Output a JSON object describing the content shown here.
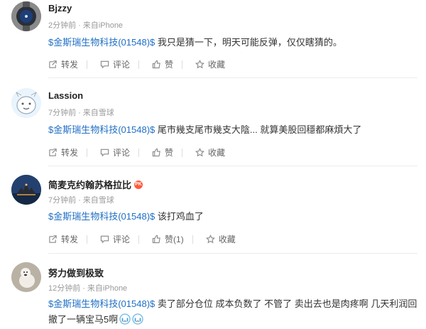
{
  "posts": [
    {
      "name": "Bjzzy",
      "time": "2分钟前",
      "source": "来自iPhone",
      "stock": "$金斯瑞生物科技(01548)$",
      "text": "我只是猜一下，明天可能反弹，仅仅瞎猜的。",
      "repost": "转发",
      "comment": "评论",
      "like": "赞",
      "fav": "收藏"
    },
    {
      "name": "Lassion",
      "time": "7分钟前",
      "source": "来自雪球",
      "stock": "$金斯瑞生物科技(01548)$",
      "text": "尾市幾支尾市幾支大陰... 就算美股回穩都麻煩大了",
      "repost": "转发",
      "comment": "评论",
      "like": "赞",
      "fav": "收藏"
    },
    {
      "name": "简麦克约翰苏格拉比",
      "badge": "PK",
      "time": "7分钟前",
      "source": "来自雪球",
      "stock": "$金斯瑞生物科技(01548)$",
      "text": "该打鸡血了",
      "repost": "转发",
      "comment": "评论",
      "like": "赞(1)",
      "fav": "收藏"
    },
    {
      "name": "努力做到极致",
      "time": "12分钟前",
      "source": "来自iPhone",
      "stock": "$金斯瑞生物科技(01548)$",
      "text": "卖了部分仓位 成本负数了 不管了 卖出去也是肉疼啊 几天利润回撤了一辆宝马5啊"
    }
  ],
  "separator": "·",
  "icons": [
    "share-icon",
    "comment-icon",
    "thumb-up-icon",
    "star-icon",
    "crying-emoji-icon"
  ]
}
